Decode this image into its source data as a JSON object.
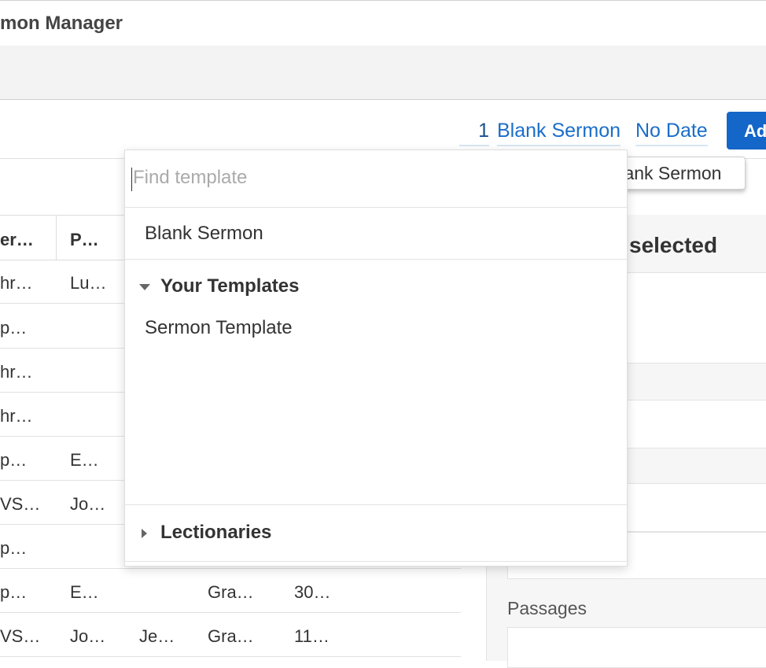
{
  "app": {
    "title": "mon Manager"
  },
  "toolbar": {
    "count": "1",
    "template_link": "Blank Sermon",
    "date_link": "No Date",
    "add_label": "Ad",
    "tooltip": "Blank Sermon"
  },
  "table": {
    "headers": [
      "er…",
      "P…"
    ],
    "rows": [
      [
        "hr…",
        "Lu…",
        "",
        "",
        ""
      ],
      [
        "p…",
        "",
        "",
        "",
        ""
      ],
      [
        "hr…",
        "",
        "",
        "",
        ""
      ],
      [
        "hr…",
        "",
        "",
        "",
        ""
      ],
      [
        "p…",
        "E…",
        "",
        "",
        ""
      ],
      [
        "VS…",
        "Jo…",
        "",
        "",
        ""
      ],
      [
        "p…",
        "",
        "",
        "",
        ""
      ],
      [
        "p…",
        "E…",
        "",
        "Gra…",
        "30…"
      ],
      [
        "VS…",
        "Jo…",
        "Je…",
        "Gra…",
        "11…"
      ]
    ]
  },
  "right_panel": {
    "title": "selected",
    "passages_label": "Passages"
  },
  "dropdown": {
    "search_placeholder": "Find template",
    "blank_item": "Blank Sermon",
    "your_templates_label": "Your Templates",
    "your_templates": [
      "Sermon Template"
    ],
    "lectionaries_label": "Lectionaries"
  },
  "colors": {
    "accent": "#1466c8",
    "link": "#1a6ec8"
  }
}
